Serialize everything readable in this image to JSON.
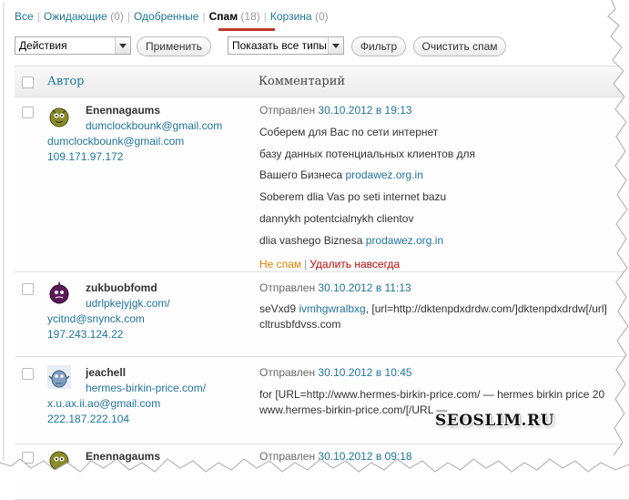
{
  "filters": {
    "all": "Все",
    "pending": "Ожидающие",
    "pending_count": "(0)",
    "approved": "Одобренные",
    "spam": "Спам",
    "spam_count": "(18)",
    "trash": "Корзина",
    "trash_count": "(0)",
    "separator": "|"
  },
  "toolbar": {
    "bulk_actions": "Действия",
    "apply": "Применить",
    "type_filter": "Показать все типы",
    "filter": "Фильтр",
    "empty_spam": "Очистить спам"
  },
  "table": {
    "col_author": "Автор",
    "col_comment": "Комментарий"
  },
  "comments": [
    {
      "name": "Enennagaums",
      "line1": "dumclockbounk@gmail.com",
      "line2": "dumclockbounk@gmail.com",
      "ip": "109.171.97.172",
      "submitted": "Отправлен",
      "date": "30.10.2012 в 19:13",
      "text": [
        "Соберем для Вас по сети интернет",
        "базу данных потенциальных клиентов для",
        "Вашего Бизнеса",
        "Soberem dlia Vas po seti internet bazu",
        "dannykh potentcialnykh clientov",
        "dlia vashego Biznesa"
      ],
      "link1": "prodawez.org.in",
      "link2": "prodawez.org.in",
      "not_spam": "Не спам",
      "delete": "Удалить навсегда",
      "avatar_color": "#8a8a2a"
    },
    {
      "name": "zukbuobfomd",
      "line1": "udrlpkejyjgk.com/",
      "line2": "ycitnd@snynck.com",
      "ip": "197.243.124.22",
      "submitted": "Отправлен",
      "date": "30.10.2012 в 11:13",
      "text_prefix": "seVxd9",
      "text_link": "ivmhgwralbxg",
      "text_rest": ", [url=http://dktenpdxdrdw.com/]dktenpdxdrdw[/url]",
      "text2": "cltrusbfdvss.com",
      "avatar_color": "#5a1a5a"
    },
    {
      "name": "jeachell",
      "line1": "hermes-birkin-price.com/",
      "line2": "x.u.ax.ii.ao@gmail.com",
      "ip": "222.187.222.104",
      "submitted": "Отправлен",
      "date": "30.10.2012 в 10:45",
      "text1": "for [URL=http://www.hermes-birkin-price.com/ — hermes birkin price 20",
      "text2": "www.hermes-birkin-price.com/[/URL —",
      "avatar_color": "#7fa0c0"
    },
    {
      "name": "Enennagaums",
      "submitted": "Отправлен",
      "date": "30.10.2012 в 09:18",
      "avatar_color": "#8a8a2a"
    }
  ],
  "watermark": "SEOSLIM.RU"
}
